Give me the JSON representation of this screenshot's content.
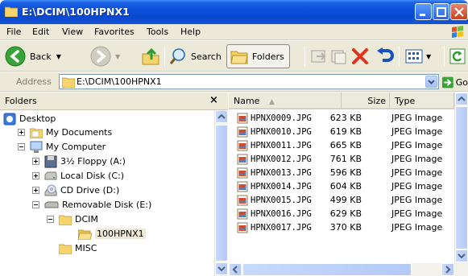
{
  "window": {
    "title": "E:\\DCIM\\100HPNX1"
  },
  "menu": [
    "File",
    "Edit",
    "View",
    "Favorites",
    "Tools",
    "Help"
  ],
  "toolbar": {
    "back_label": "Back",
    "search_label": "Search",
    "folders_label": "Folders"
  },
  "address": {
    "label": "Address",
    "value": "E:\\DCIM\\100HPNX1",
    "go_label": "Go"
  },
  "folders_pane": {
    "title": "Folders",
    "close_glyph": "×",
    "tree": [
      {
        "label": "Desktop",
        "icon": "desktop-icon"
      },
      {
        "label": "My Documents",
        "icon": "folder-icon"
      },
      {
        "label": "My Computer",
        "icon": "computer-icon"
      },
      {
        "label": "3½ Floppy (A:)",
        "icon": "floppy-icon"
      },
      {
        "label": "Local Disk (C:)",
        "icon": "hard-disk-icon"
      },
      {
        "label": "CD Drive (D:)",
        "icon": "cd-drive-icon"
      },
      {
        "label": "Removable Disk (E:)",
        "icon": "removable-disk-icon"
      },
      {
        "label": "DCIM",
        "icon": "folder-icon"
      },
      {
        "label": "100HPNX1",
        "icon": "open-folder-icon"
      },
      {
        "label": "MISC",
        "icon": "folder-icon"
      }
    ]
  },
  "files": {
    "columns": {
      "name": "Name",
      "size": "Size",
      "type": "Type"
    },
    "rows": [
      {
        "name": "HPNX0009.JPG",
        "size": "623 KB",
        "type": "JPEG Image"
      },
      {
        "name": "HPNX0010.JPG",
        "size": "619 KB",
        "type": "JPEG Image"
      },
      {
        "name": "HPNX0011.JPG",
        "size": "665 KB",
        "type": "JPEG Image"
      },
      {
        "name": "HPNX0012.JPG",
        "size": "761 KB",
        "type": "JPEG Image"
      },
      {
        "name": "HPNX0013.JPG",
        "size": "596 KB",
        "type": "JPEG Image"
      },
      {
        "name": "HPNX0014.JPG",
        "size": "604 KB",
        "type": "JPEG Image"
      },
      {
        "name": "HPNX0015.JPG",
        "size": "499 KB",
        "type": "JPEG Image"
      },
      {
        "name": "HPNX0016.JPG",
        "size": "629 KB",
        "type": "JPEG Image"
      },
      {
        "name": "HPNX0017.JPG",
        "size": "370 KB",
        "type": "JPEG Image"
      }
    ]
  },
  "colors": {
    "title_bar": "#0a4ed6",
    "chrome": "#ece9d8",
    "close_button": "#d7542d",
    "delete_x": "#e0321c"
  }
}
